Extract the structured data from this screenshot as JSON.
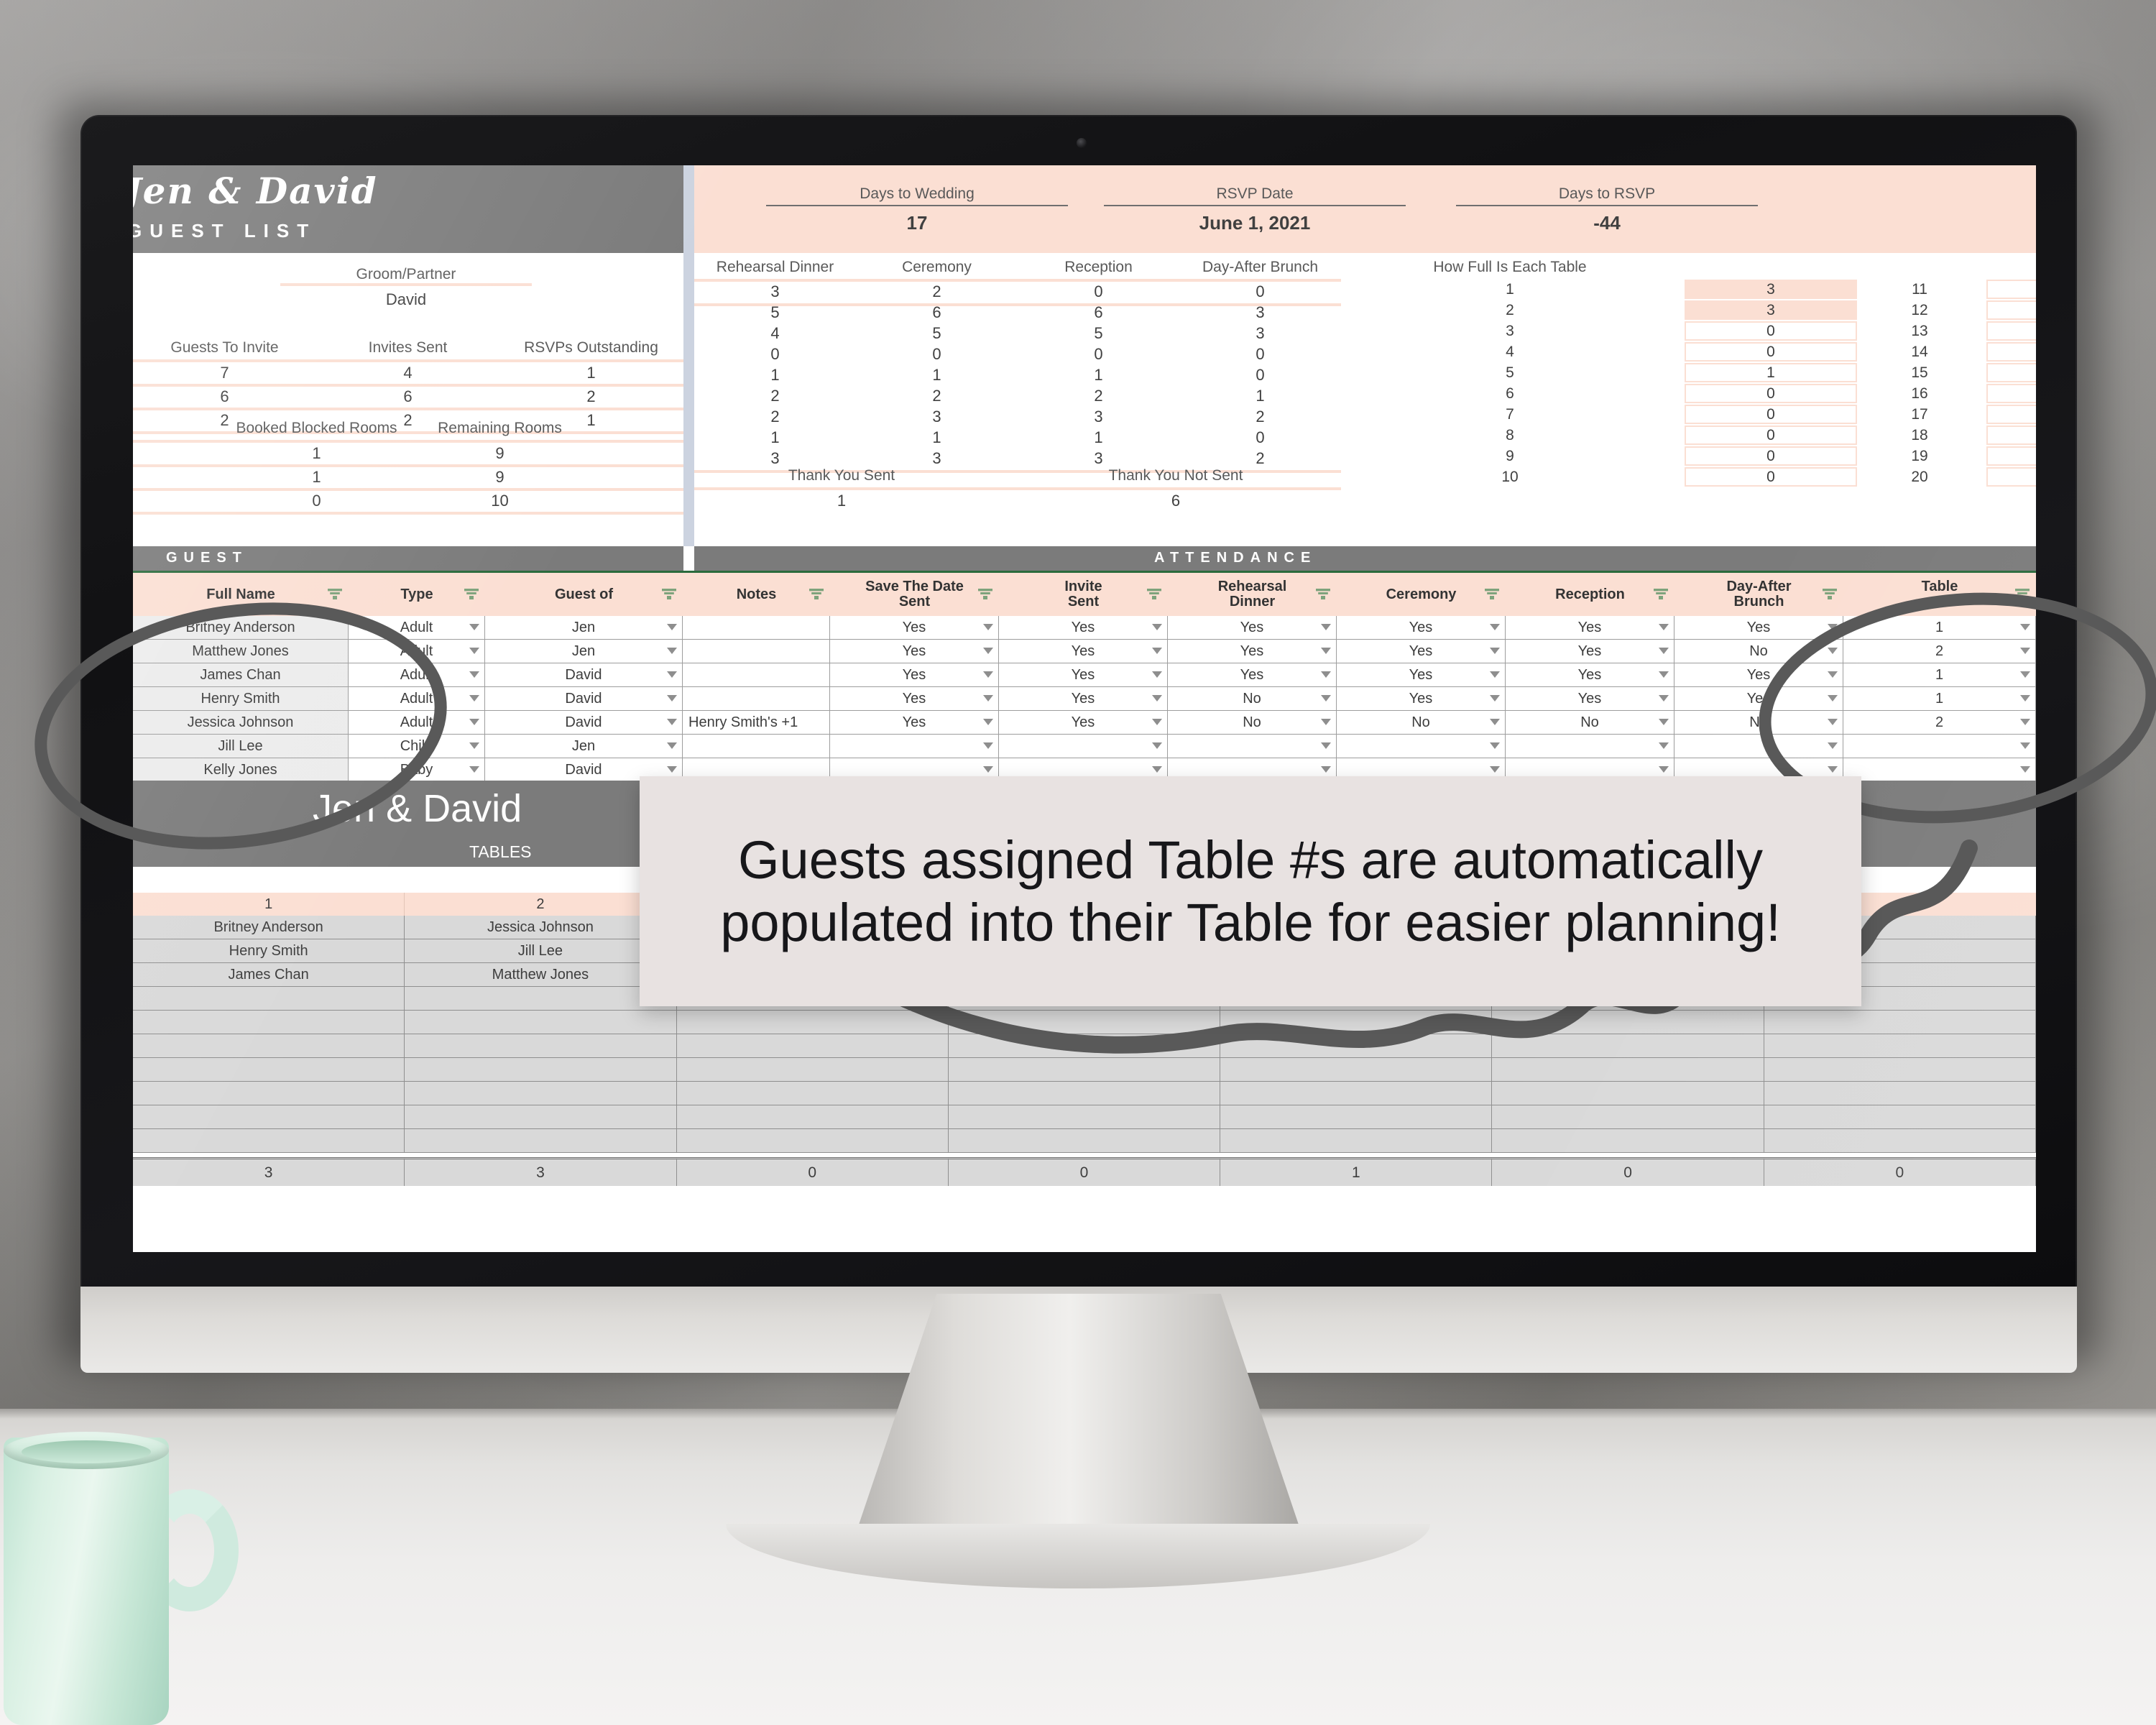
{
  "theme": {
    "banner_gray": "#7b7b7b",
    "header_pink": "#fbdfd3",
    "row_shade": "#ececec",
    "table_fill": "#d9d9d9",
    "accent_green": "#2a6a3c",
    "callout_bg": "#e8e2e1"
  },
  "sheet1": {
    "couple": "Jen & David",
    "section_title": "GUEST LIST",
    "partner_label": "Groom/Partner",
    "partner_name": "David",
    "summary_headers": [
      "Guests To Invite",
      "Invites Sent",
      "RSVPs Outstanding"
    ],
    "summary_rows": [
      [
        "7",
        "4",
        "1"
      ],
      [
        "6",
        "6",
        "2"
      ],
      [
        "2",
        "2",
        "1"
      ]
    ],
    "rooms_headers": [
      "Booked Blocked Rooms",
      "Remaining Rooms"
    ],
    "rooms_rows": [
      [
        "1",
        "9"
      ],
      [
        "1",
        "9"
      ],
      [
        "0",
        "10"
      ]
    ]
  },
  "kpis": [
    {
      "label": "Days to Wedding",
      "value": "17"
    },
    {
      "label": "RSVP Date",
      "value": "June 1, 2021"
    },
    {
      "label": "Days to RSVP",
      "value": "-44"
    }
  ],
  "event_counts": {
    "headers": [
      "Rehearsal Dinner",
      "Ceremony",
      "Reception",
      "Day-After Brunch"
    ],
    "rows": [
      [
        "3",
        "2",
        "0",
        "0"
      ],
      [
        "5",
        "6",
        "6",
        "3"
      ],
      [
        "4",
        "5",
        "5",
        "3"
      ],
      [
        "0",
        "0",
        "0",
        "0"
      ],
      [
        "1",
        "1",
        "1",
        "0"
      ],
      [
        "2",
        "2",
        "2",
        "1"
      ],
      [
        "2",
        "3",
        "3",
        "2"
      ],
      [
        "1",
        "1",
        "1",
        "0"
      ],
      [
        "3",
        "3",
        "3",
        "2"
      ]
    ]
  },
  "thank_you": {
    "sent_label": "Thank You Sent",
    "sent_value": "1",
    "not_sent_label": "Thank You Not Sent",
    "not_sent_value": "6"
  },
  "table_fullness": {
    "title": "How Full Is Each Table",
    "left_numbers": [
      "1",
      "2",
      "3",
      "4",
      "5",
      "6",
      "7",
      "8",
      "9",
      "10"
    ],
    "left_values": [
      "3",
      "3",
      "0",
      "0",
      "1",
      "0",
      "0",
      "0",
      "0",
      "0"
    ],
    "right_numbers": [
      "11",
      "12",
      "13",
      "14",
      "15",
      "16",
      "17",
      "18",
      "19",
      "20"
    ],
    "right_values": [
      "",
      "",
      "",
      "",
      "",
      "",
      "",
      "",
      "",
      ""
    ]
  },
  "guest_table": {
    "guest_band": "GUEST",
    "attendance_band": "ATTENDANCE",
    "columns": [
      {
        "label": "Full Name",
        "filter": true
      },
      {
        "label": "Type",
        "filter": true
      },
      {
        "label": "Guest of",
        "filter": true
      },
      {
        "label": "Notes",
        "filter": true
      },
      {
        "label": "Save The Date\nSent",
        "line1": "Save The Date",
        "line2": "Sent",
        "filter": true
      },
      {
        "label": "Invite\nSent",
        "line1": "Invite",
        "line2": "Sent",
        "filter": true
      },
      {
        "label": "Rehearsal\nDinner",
        "line1": "Rehearsal",
        "line2": "Dinner",
        "filter": true
      },
      {
        "label": "Ceremony",
        "filter": true
      },
      {
        "label": "Reception",
        "filter": true
      },
      {
        "label": "Day-After\nBrunch",
        "line1": "Day-After",
        "line2": "Brunch",
        "filter": true
      },
      {
        "label": "Table\n#",
        "line1": "Table",
        "line2": "#",
        "filter": true
      }
    ],
    "rows": [
      {
        "name": "Britney Anderson",
        "type": "Adult",
        "guest_of": "Jen",
        "notes": "",
        "save_the_date": "Yes",
        "invite": "Yes",
        "rehearsal": "Yes",
        "ceremony": "Yes",
        "reception": "Yes",
        "brunch": "Yes",
        "table": "1"
      },
      {
        "name": "Matthew Jones",
        "type": "Adult",
        "guest_of": "Jen",
        "notes": "",
        "save_the_date": "Yes",
        "invite": "Yes",
        "rehearsal": "Yes",
        "ceremony": "Yes",
        "reception": "Yes",
        "brunch": "No",
        "table": "2"
      },
      {
        "name": "James Chan",
        "type": "Adult",
        "guest_of": "David",
        "notes": "",
        "save_the_date": "Yes",
        "invite": "Yes",
        "rehearsal": "Yes",
        "ceremony": "Yes",
        "reception": "Yes",
        "brunch": "Yes",
        "table": "1"
      },
      {
        "name": "Henry Smith",
        "type": "Adult",
        "guest_of": "David",
        "notes": "",
        "save_the_date": "Yes",
        "invite": "Yes",
        "rehearsal": "No",
        "ceremony": "Yes",
        "reception": "Yes",
        "brunch": "Yes",
        "table": "1"
      },
      {
        "name": "Jessica Johnson",
        "type": "Adult",
        "guest_of": "David",
        "notes": "Henry Smith's +1",
        "save_the_date": "Yes",
        "invite": "Yes",
        "rehearsal": "No",
        "ceremony": "No",
        "reception": "No",
        "brunch": "No",
        "table": "2"
      },
      {
        "name": "Jill Lee",
        "type": "Child",
        "guest_of": "Jen",
        "notes": "",
        "save_the_date": "",
        "invite": "",
        "rehearsal": "",
        "ceremony": "",
        "reception": "",
        "brunch": "",
        "table": ""
      },
      {
        "name": "Kelly Jones",
        "type": "Baby",
        "guest_of": "David",
        "notes": "",
        "save_the_date": "",
        "invite": "",
        "rehearsal": "",
        "ceremony": "",
        "reception": "",
        "brunch": "",
        "table": ""
      }
    ]
  },
  "sheet2": {
    "couple": "Jen & David",
    "section_title": "TABLES",
    "table_numbers": [
      "1",
      "2",
      "",
      "",
      "",
      "",
      ""
    ],
    "seats": [
      [
        "Britney Anderson",
        "Jessica Johnson",
        "",
        "",
        "",
        "",
        ""
      ],
      [
        "Henry Smith",
        "Jill Lee",
        "",
        "",
        "",
        "",
        ""
      ],
      [
        "James Chan",
        "Matthew Jones",
        "",
        "",
        "",
        "",
        ""
      ],
      [
        "",
        "",
        "",
        "",
        "",
        "",
        ""
      ],
      [
        "",
        "",
        "",
        "",
        "",
        "",
        ""
      ],
      [
        "",
        "",
        "",
        "",
        "",
        "",
        ""
      ],
      [
        "",
        "",
        "",
        "",
        "",
        "",
        ""
      ],
      [
        "",
        "",
        "",
        "",
        "",
        "",
        ""
      ],
      [
        "",
        "",
        "",
        "",
        "",
        "",
        ""
      ],
      [
        "",
        "",
        "",
        "",
        "",
        "",
        ""
      ]
    ],
    "totals": [
      "3",
      "3",
      "0",
      "0",
      "1",
      "0",
      "0"
    ]
  },
  "callout": {
    "line1": "Guests assigned Table #s are automatically",
    "line2": "populated into their Table for easier planning!"
  }
}
